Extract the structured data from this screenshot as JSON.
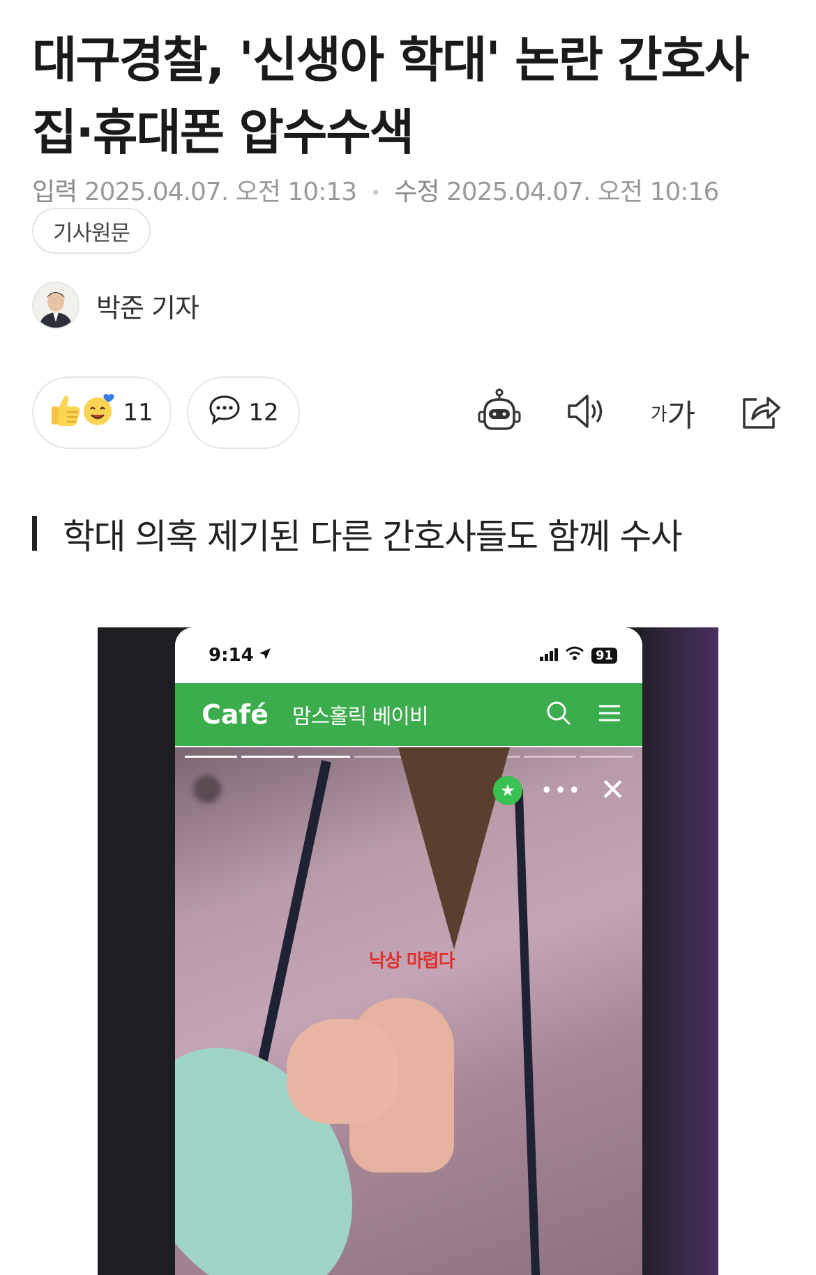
{
  "article": {
    "headline": "대구경찰, '신생아 학대' 논란 간호사 집·휴대폰 압수수색",
    "input_label": "입력",
    "input_time": "2025.04.07. 오전 10:13",
    "edit_label": "수정",
    "edit_time": "2025.04.07. 오전 10:16",
    "original_button": "기사원문",
    "reporter": "박준 기자",
    "subheadline": "학대 의혹 제기된 다른 간호사들도 함께 수사"
  },
  "actions": {
    "reaction_count": "11",
    "comment_count": "12",
    "font_size_label": "가가",
    "icons": [
      "thumbs-up-emoji-icon",
      "smile-emoji-icon",
      "comment-icon",
      "robot-summary-icon",
      "speaker-icon",
      "font-size-icon",
      "share-icon"
    ]
  },
  "photo": {
    "phone_time": "9:14",
    "battery": "91",
    "cafe_logo": "Café",
    "cafe_name": "맘스홀릭 베이비",
    "overlay_caption": "낙상 마렵다",
    "icons": [
      "location-arrow-icon",
      "signal-icon",
      "wifi-icon",
      "search-icon",
      "menu-icon",
      "star-icon",
      "more-icon",
      "close-icon"
    ]
  },
  "colors": {
    "cafe_green": "#3cad4d",
    "caption_red": "#e0302a",
    "meta_gray": "#8a8a8a"
  }
}
